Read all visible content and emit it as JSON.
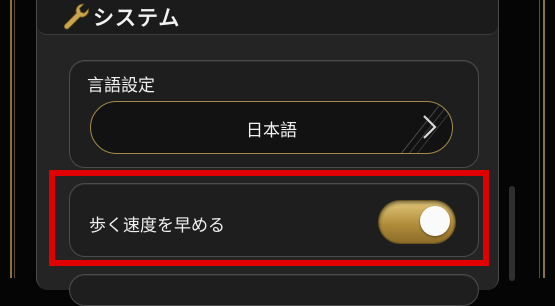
{
  "header": {
    "title": "システム",
    "icon": "wrench-icon"
  },
  "language": {
    "label": "言語設定",
    "value": "日本語",
    "icon": "chevron-right-icon"
  },
  "walk_speed": {
    "label": "歩く速度を早める",
    "enabled": true
  },
  "colors": {
    "accent_gold": "#b08d3c",
    "highlight_red": "#e10000",
    "panel_bg": "#242424"
  }
}
